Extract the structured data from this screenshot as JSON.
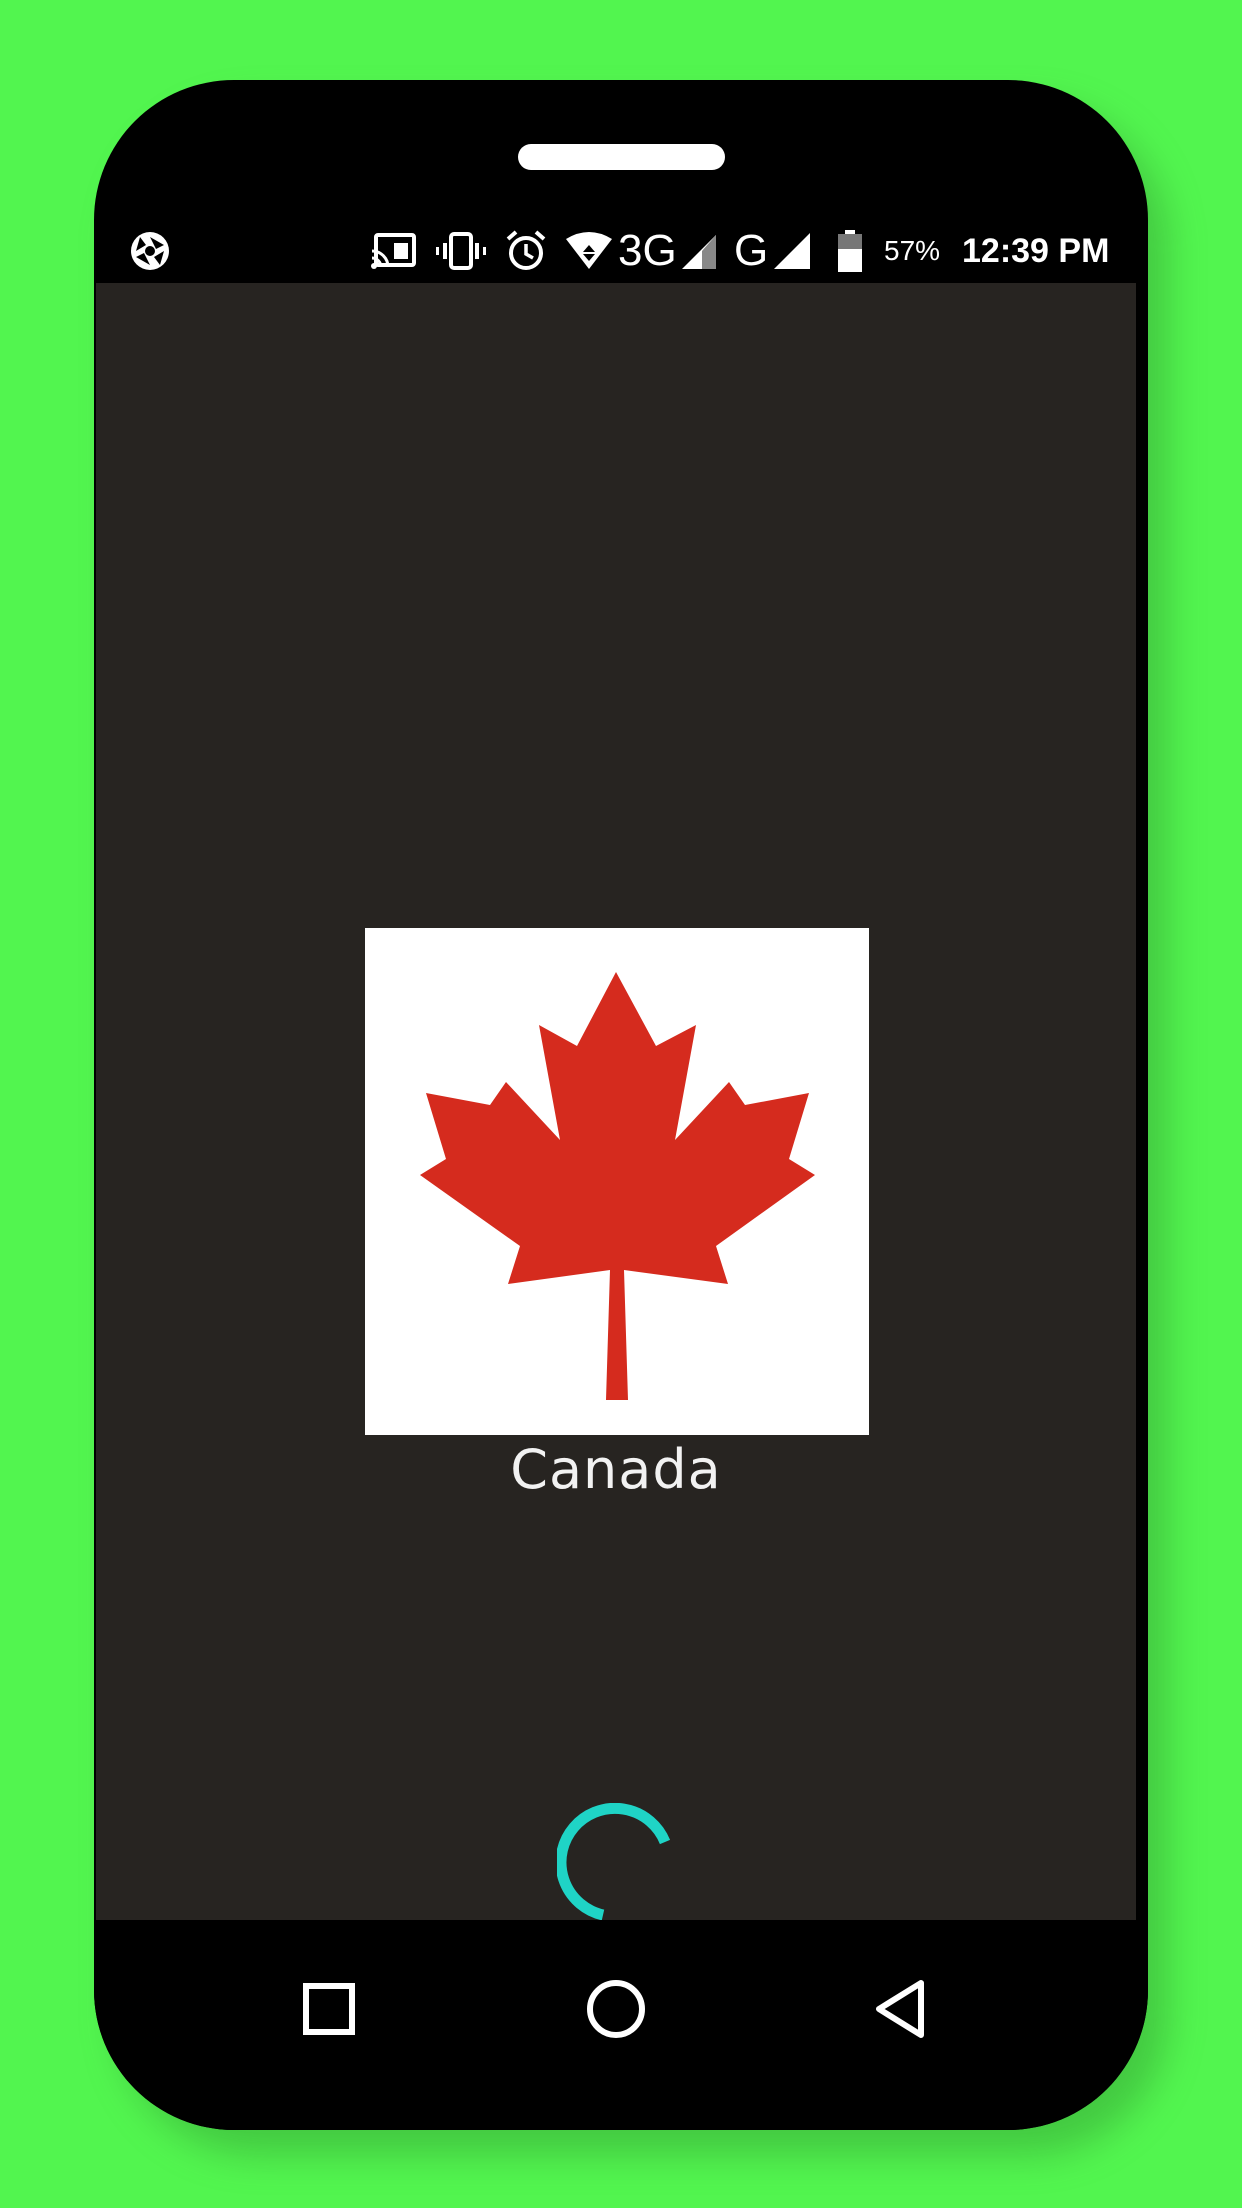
{
  "status_bar": {
    "battery_percent": "57%",
    "time": "12:39 PM",
    "network_3g": "3G",
    "network_g": "G",
    "icons": [
      "camera-shutter-icon",
      "cast-icon",
      "vibrate-icon",
      "alarm-icon",
      "wifi-icon",
      "signal-icon",
      "battery-icon"
    ]
  },
  "main": {
    "country_name": "Canada",
    "flag_icon": "maple-leaf-icon"
  },
  "loading": {
    "icon": "loading-spinner-icon",
    "accent_color": "#1fd4c6"
  },
  "nav_bar": {
    "icons": [
      "recents-square-icon",
      "home-circle-icon",
      "back-triangle-icon"
    ]
  },
  "colors": {
    "background": "#52f54f",
    "screen": "#272421",
    "leaf_red": "#d52b1e"
  }
}
